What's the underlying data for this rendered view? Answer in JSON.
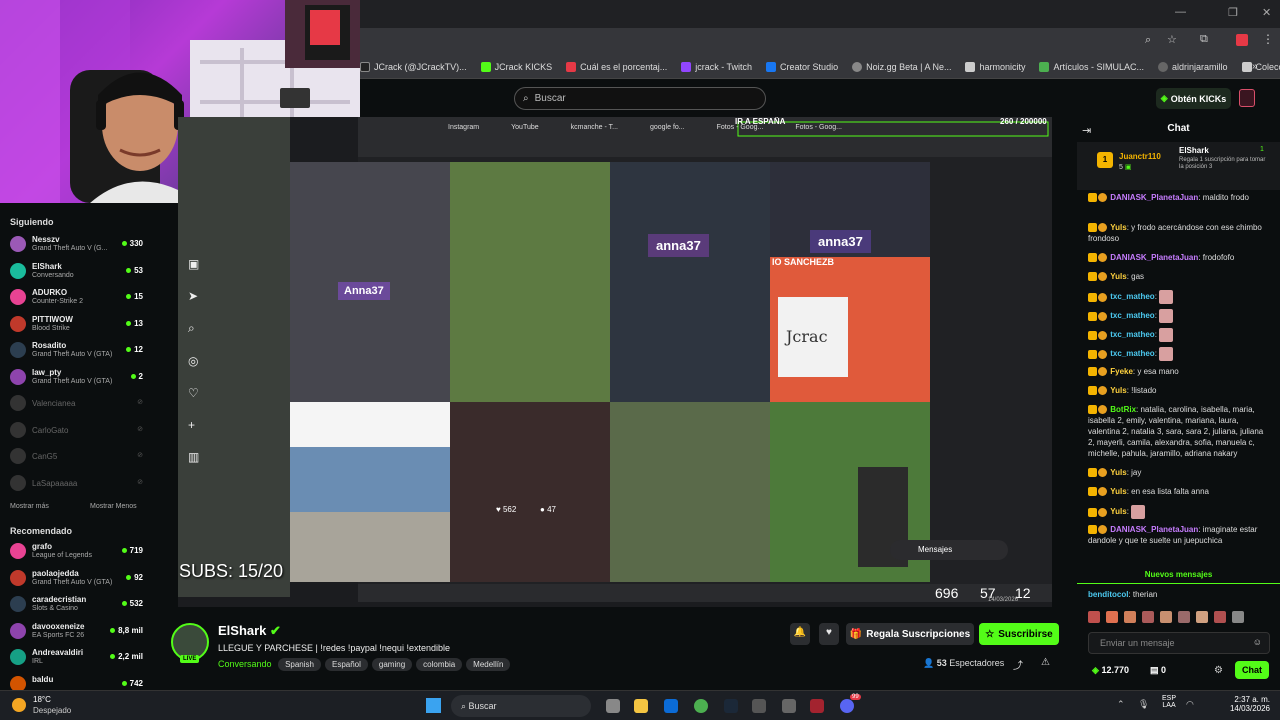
{
  "browser": {
    "bookmarks": [
      {
        "label": "JCrack (@JCrackTV)..."
      },
      {
        "label": "JCrack KICKS"
      },
      {
        "label": "Cuál es el porcentaj..."
      },
      {
        "label": "jcrack - Twitch"
      },
      {
        "label": "Creator Studio"
      },
      {
        "label": "Noiz.gg Beta | A Ne..."
      },
      {
        "label": "harmonicity"
      },
      {
        "label": "Artículos - SIMULAC..."
      },
      {
        "label": "aldrinjaramillo"
      },
      {
        "label": "Colección de M_blei..."
      }
    ],
    "overflow": "»"
  },
  "kick": {
    "search_placeholder": "Buscar",
    "kicks_button": "Obtén KICKs"
  },
  "sidebar": {
    "following_title": "Siguiendo",
    "following": [
      {
        "name": "Nesszv",
        "game": "Grand Theft Auto V (G...",
        "count": "330"
      },
      {
        "name": "ElShark",
        "game": "Conversando",
        "count": "53"
      },
      {
        "name": "ADURKO",
        "game": "Counter-Strike 2",
        "count": "15"
      },
      {
        "name": "PITTIWOW",
        "game": "Blood Strike",
        "count": "13"
      },
      {
        "name": "Rosadito",
        "game": "Grand Theft Auto V (GTA)",
        "count": "12"
      },
      {
        "name": "law_pty",
        "game": "Grand Theft Auto V (GTA)",
        "count": "2"
      }
    ],
    "offline": [
      "Valencianea",
      "CarloGato",
      "CanG5",
      "LaSapaaaaa"
    ],
    "show_more": "Mostrar más",
    "show_less": "Mostrar Menos",
    "recommended_title": "Recomendado",
    "recommended": [
      {
        "name": "grafo",
        "game": "League of Legends",
        "count": "719"
      },
      {
        "name": "paolaojedda",
        "game": "Grand Theft Auto V (GTA)",
        "count": "92"
      },
      {
        "name": "caradecristian",
        "game": "Slots & Casino",
        "count": "532"
      },
      {
        "name": "davooxeneize",
        "game": "EA Sports FC 26",
        "count": "8,8 mil"
      },
      {
        "name": "Andreavaldiri",
        "game": "IRL",
        "count": "2,2 mil"
      },
      {
        "name": "baldu",
        "game": "",
        "count": "742"
      }
    ]
  },
  "stream": {
    "top_banner": "IR A ESPAÑA",
    "counter": "260 / 200000",
    "inner_tabs": [
      "Instagram",
      "YouTube",
      "kcmanche - T...",
      "google fo...",
      "Fotos - Goog...",
      "Fotos - Goog..."
    ],
    "overlay_labels": [
      "anna37",
      "Anna37",
      "anna37"
    ],
    "paper_text": "Jcrac",
    "name_plate": "IO SANCHEZB",
    "likes": "562",
    "comments": "47",
    "subs_text": "SUBS: 15/20",
    "messages_label": "Mensajes",
    "inner_clock": "57",
    "inner_num1": "696",
    "inner_num2": "12",
    "inner_date": "14/03/2026"
  },
  "channel": {
    "name": "ElShark",
    "live_badge": "LIVE",
    "title": "LLEGUE Y PARCHESE | !redes !paypal !nequi !extendible",
    "category": "Conversando",
    "tags": [
      "Spanish",
      "Español",
      "gaming",
      "colombia",
      "Medellín"
    ],
    "gift_button": "Regala Suscripciones",
    "subscribe_button": "Suscribirse",
    "viewers": "53",
    "viewers_label": "Espectadores"
  },
  "chat": {
    "title": "Chat",
    "pinned_user": "Juanctr110",
    "pinned_user_count": "5",
    "pinned_gift_user": "ElShark",
    "pinned_gift_count": "1",
    "pinned_text": "Regala 1 suscripción para tomar la posición 3",
    "messages": [
      {
        "user": "DANIASK_PlanetaJuan",
        "text": "maldito frodo",
        "color": "#c77dff"
      },
      {
        "user": "Yuls",
        "text": "y frodo acercándose con ese chimbo frondoso",
        "color": "#ffd23f"
      },
      {
        "user": "DANIASK_PlanetaJuan",
        "text": "frodofofo",
        "color": "#c77dff"
      },
      {
        "user": "Yuls",
        "text": "gas",
        "color": "#ffd23f"
      },
      {
        "user": "txc_matheo",
        "text": "",
        "color": "#4cc9f0"
      },
      {
        "user": "txc_matheo",
        "text": "",
        "color": "#4cc9f0"
      },
      {
        "user": "txc_matheo",
        "text": "",
        "color": "#4cc9f0"
      },
      {
        "user": "txc_matheo",
        "text": "",
        "color": "#4cc9f0"
      },
      {
        "user": "Fyeke",
        "text": "y esa mano",
        "color": "#ffd23f"
      },
      {
        "user": "Yuls",
        "text": "!listado",
        "color": "#ffd23f"
      },
      {
        "user": "BotRix",
        "text": "natalia, carolina, isabella, maria, isabella 2, emily, valentina, mariana, laura, valentina 2, natalia 3, sara, sara 2, juliana, juliana 2, mayerli, camila, alexandra, sofia, manuela c, michelle, pahula, jaramillo, adriana nakary",
        "color": "#53fc18"
      },
      {
        "user": "Yuls",
        "text": "jay",
        "color": "#ffd23f"
      },
      {
        "user": "Yuls",
        "text": "en esa lista falta anna",
        "color": "#ffd23f"
      },
      {
        "user": "Yuls",
        "text": "",
        "color": "#ffd23f"
      },
      {
        "user": "DANIASK_PlanetaJuan",
        "text": "imaginate estar dandole y que te suelte un juepuchica",
        "color": "#c77dff"
      }
    ],
    "new_messages": "Nuevos mensajes",
    "last_user": "benditocol",
    "last_text": "therian",
    "input_placeholder": "Enviar un mensaje",
    "kicks_balance": "12.770",
    "points": "0",
    "send_button": "Chat"
  },
  "taskbar": {
    "weather_temp": "18°C",
    "weather_desc": "Despejado",
    "search": "Buscar",
    "lang": "ESP",
    "lang2": "LAA",
    "time": "2:37 a. m.",
    "date": "14/03/2026",
    "badge": "99"
  },
  "colors": {
    "kick_green": "#53fc18",
    "bg": "#0b0e0f"
  }
}
